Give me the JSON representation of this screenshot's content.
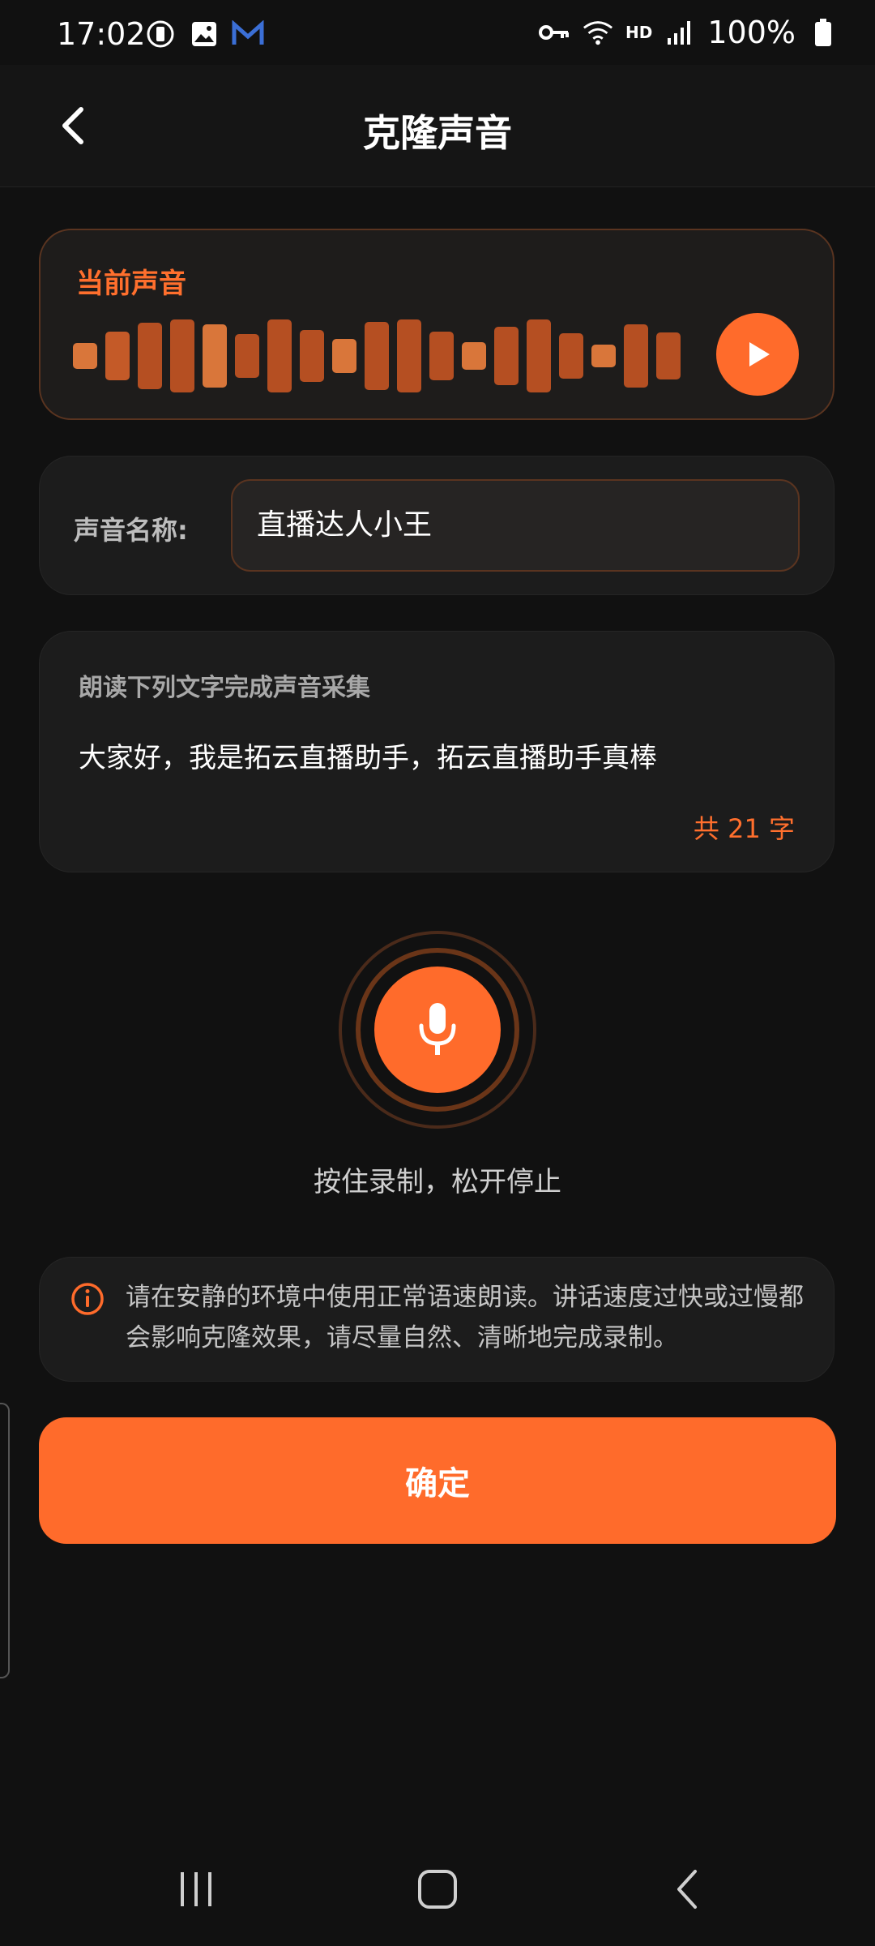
{
  "status_bar": {
    "time": "17:02",
    "battery": "100%",
    "network_label": "HD"
  },
  "header": {
    "title": "克隆声音"
  },
  "current_voice": {
    "label": "当前声音"
  },
  "voice_name": {
    "label": "声音名称:",
    "value": "直播达人小王"
  },
  "reading": {
    "instruction": "朗读下列文字完成声音采集",
    "text": "大家好，我是拓云直播助手，拓云直播助手真棒",
    "count": "共 21 字"
  },
  "record": {
    "hint": "按住录制，松开停止"
  },
  "tip": {
    "text": "请在安静的环境中使用正常语速朗读。讲话速度过快或过慢都会影响克隆效果，请尽量自然、清晰地完成录制。"
  },
  "confirm_button": {
    "label": "确定"
  },
  "colors": {
    "accent": "#ff6b2b",
    "background": "#111111"
  }
}
